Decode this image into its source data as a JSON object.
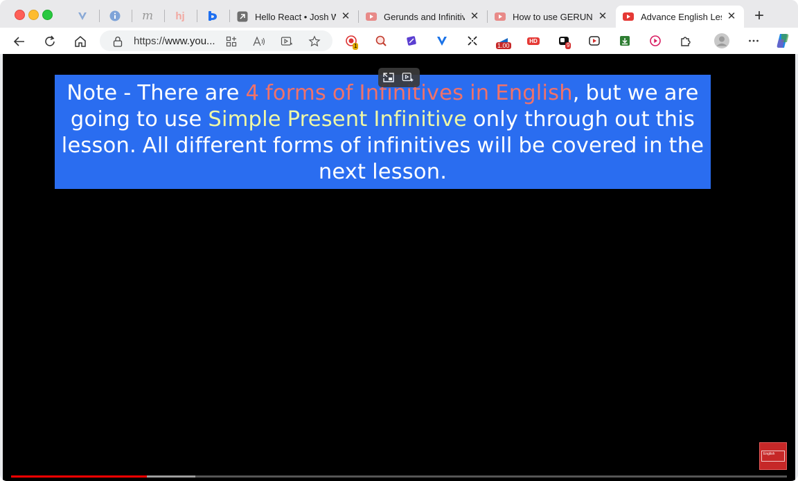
{
  "window": {
    "title": "Advance English Lesson"
  },
  "pinned_tabs": [
    {
      "icon": "v-extension-icon"
    },
    {
      "icon": "info-icon"
    },
    {
      "icon": "m-logo-icon",
      "text": "m"
    },
    {
      "icon": "hj-logo-icon",
      "text": "hj"
    },
    {
      "icon": "d-logo-icon"
    }
  ],
  "tabs": [
    {
      "title": "Hello React • Josh W",
      "icon": "arrow-up-right-icon",
      "active": false
    },
    {
      "title": "Gerunds and Infinitive",
      "icon": "youtube-icon",
      "active": false
    },
    {
      "title": "How to use GERUND",
      "icon": "youtube-icon",
      "active": false
    },
    {
      "title": "Advance English Lesso",
      "icon": "youtube-icon",
      "active": true
    }
  ],
  "toolbar": {
    "url_scheme": "https://",
    "url_host": "www.you...",
    "speed_badge": "1.00",
    "ext_badge_count": "1",
    "hd_label": "HD",
    "red_badge": "9"
  },
  "video": {
    "banner_parts": [
      {
        "text": "Note - There are ",
        "style": "plain"
      },
      {
        "text": "4 forms of Infinitives in English",
        "style": "red"
      },
      {
        "text": ", but we are going to use ",
        "style": "plain"
      },
      {
        "text": "Simple Present Infinitive",
        "style": "yellow"
      },
      {
        "text": " only through out this lesson. All different forms of infinitives will be covered in the next lesson.",
        "style": "plain"
      }
    ],
    "watermark": "English"
  },
  "colors": {
    "banner_bg": "#2a6df0",
    "highlight_red": "#f0726a",
    "highlight_yellow": "#eef7a6",
    "youtube_red": "#e53935"
  }
}
